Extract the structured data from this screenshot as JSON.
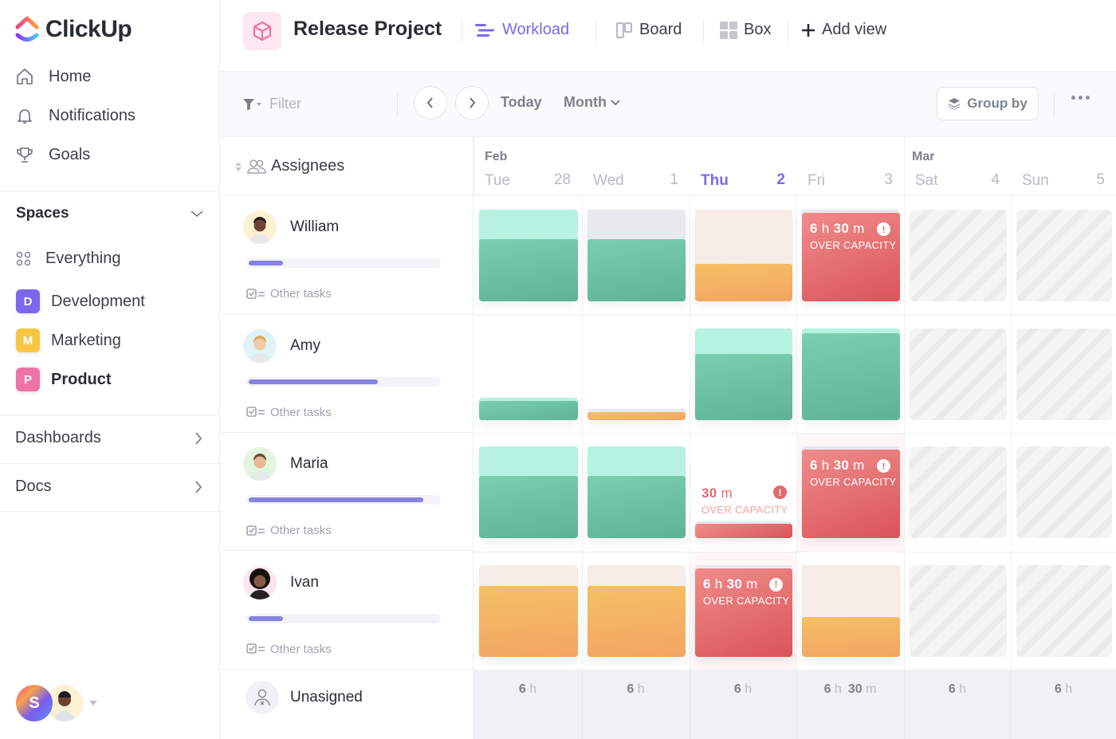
{
  "app": {
    "brand": "ClickUp"
  },
  "sidebar": {
    "nav": [
      {
        "label": "Home",
        "icon": "home-icon"
      },
      {
        "label": "Notifications",
        "icon": "bell-icon"
      },
      {
        "label": "Goals",
        "icon": "trophy-icon"
      }
    ],
    "spaces_title": "Spaces",
    "everything_label": "Everything",
    "spaces": [
      {
        "letter": "D",
        "label": "Development",
        "color": "#7b68ee"
      },
      {
        "letter": "M",
        "label": "Marketing",
        "color": "#f8c642"
      },
      {
        "letter": "P",
        "label": "Product",
        "color": "#ee74a7"
      }
    ],
    "dashboards_label": "Dashboards",
    "docs_label": "Docs",
    "user_initial": "S"
  },
  "header": {
    "project_title": "Release Project",
    "views": [
      {
        "label": "Workload",
        "active": true
      },
      {
        "label": "Board",
        "active": false
      },
      {
        "label": "Box",
        "active": false
      }
    ],
    "add_view_label": "Add view"
  },
  "toolbar": {
    "filter_placeholder": "Filter",
    "today_label": "Today",
    "range_label": "Month",
    "group_by_label": "Group by"
  },
  "assignees_header": "Assignees",
  "people": [
    {
      "name": "William",
      "progress": 0.18,
      "other_tasks": "Other tasks"
    },
    {
      "name": "Amy",
      "progress": 0.68,
      "other_tasks": "Other tasks"
    },
    {
      "name": "Maria",
      "progress": 0.92,
      "other_tasks": "Other tasks"
    },
    {
      "name": "Ivan",
      "progress": 0.18,
      "other_tasks": "Other tasks"
    }
  ],
  "unassigned_label": "Unasigned",
  "calendar": {
    "months": [
      {
        "label": "Feb"
      },
      {
        "label": "Mar"
      }
    ],
    "days": [
      {
        "name": "Tue",
        "num": "28",
        "today": false
      },
      {
        "name": "Wed",
        "num": "1",
        "today": false
      },
      {
        "name": "Thu",
        "num": "2",
        "today": true
      },
      {
        "name": "Fri",
        "num": "3",
        "today": false
      },
      {
        "name": "Sat",
        "num": "4",
        "today": false
      },
      {
        "name": "Sun",
        "num": "5",
        "today": false
      }
    ],
    "over_capacity_label": "OVER CAPACITY",
    "workload": [
      [
        {
          "type": "green",
          "fill": 0.68
        },
        {
          "type": "grey-green",
          "fill": 0.68
        },
        {
          "type": "yellow",
          "fill": 0.41
        },
        {
          "type": "over",
          "hours": "6",
          "minutes": "30"
        },
        {
          "type": "off"
        },
        {
          "type": "off"
        }
      ],
      [
        {
          "type": "green-small",
          "fill": 1.0
        },
        {
          "type": "yellow-tiny",
          "fill": 1.0
        },
        {
          "type": "green",
          "fill": 0.72
        },
        {
          "type": "green",
          "fill": 0.94
        },
        {
          "type": "off"
        },
        {
          "type": "off"
        }
      ],
      [
        {
          "type": "green",
          "fill": 0.68
        },
        {
          "type": "green",
          "fill": 0.68
        },
        {
          "type": "over-small",
          "minutes": "30"
        },
        {
          "type": "over",
          "hours": "6",
          "minutes": "30"
        },
        {
          "type": "off"
        },
        {
          "type": "off"
        }
      ],
      [
        {
          "type": "yellow",
          "fill": 0.77
        },
        {
          "type": "yellow",
          "fill": 0.77
        },
        {
          "type": "over",
          "hours": "6",
          "minutes": "30"
        },
        {
          "type": "yellow",
          "fill": 0.43
        },
        {
          "type": "off"
        },
        {
          "type": "off"
        }
      ]
    ],
    "capacity": [
      {
        "h": "6",
        "m": ""
      },
      {
        "h": "6",
        "m": ""
      },
      {
        "h": "6",
        "m": ""
      },
      {
        "h": "6",
        "m": "30"
      },
      {
        "h": "6",
        "m": ""
      },
      {
        "h": "6",
        "m": ""
      }
    ]
  }
}
